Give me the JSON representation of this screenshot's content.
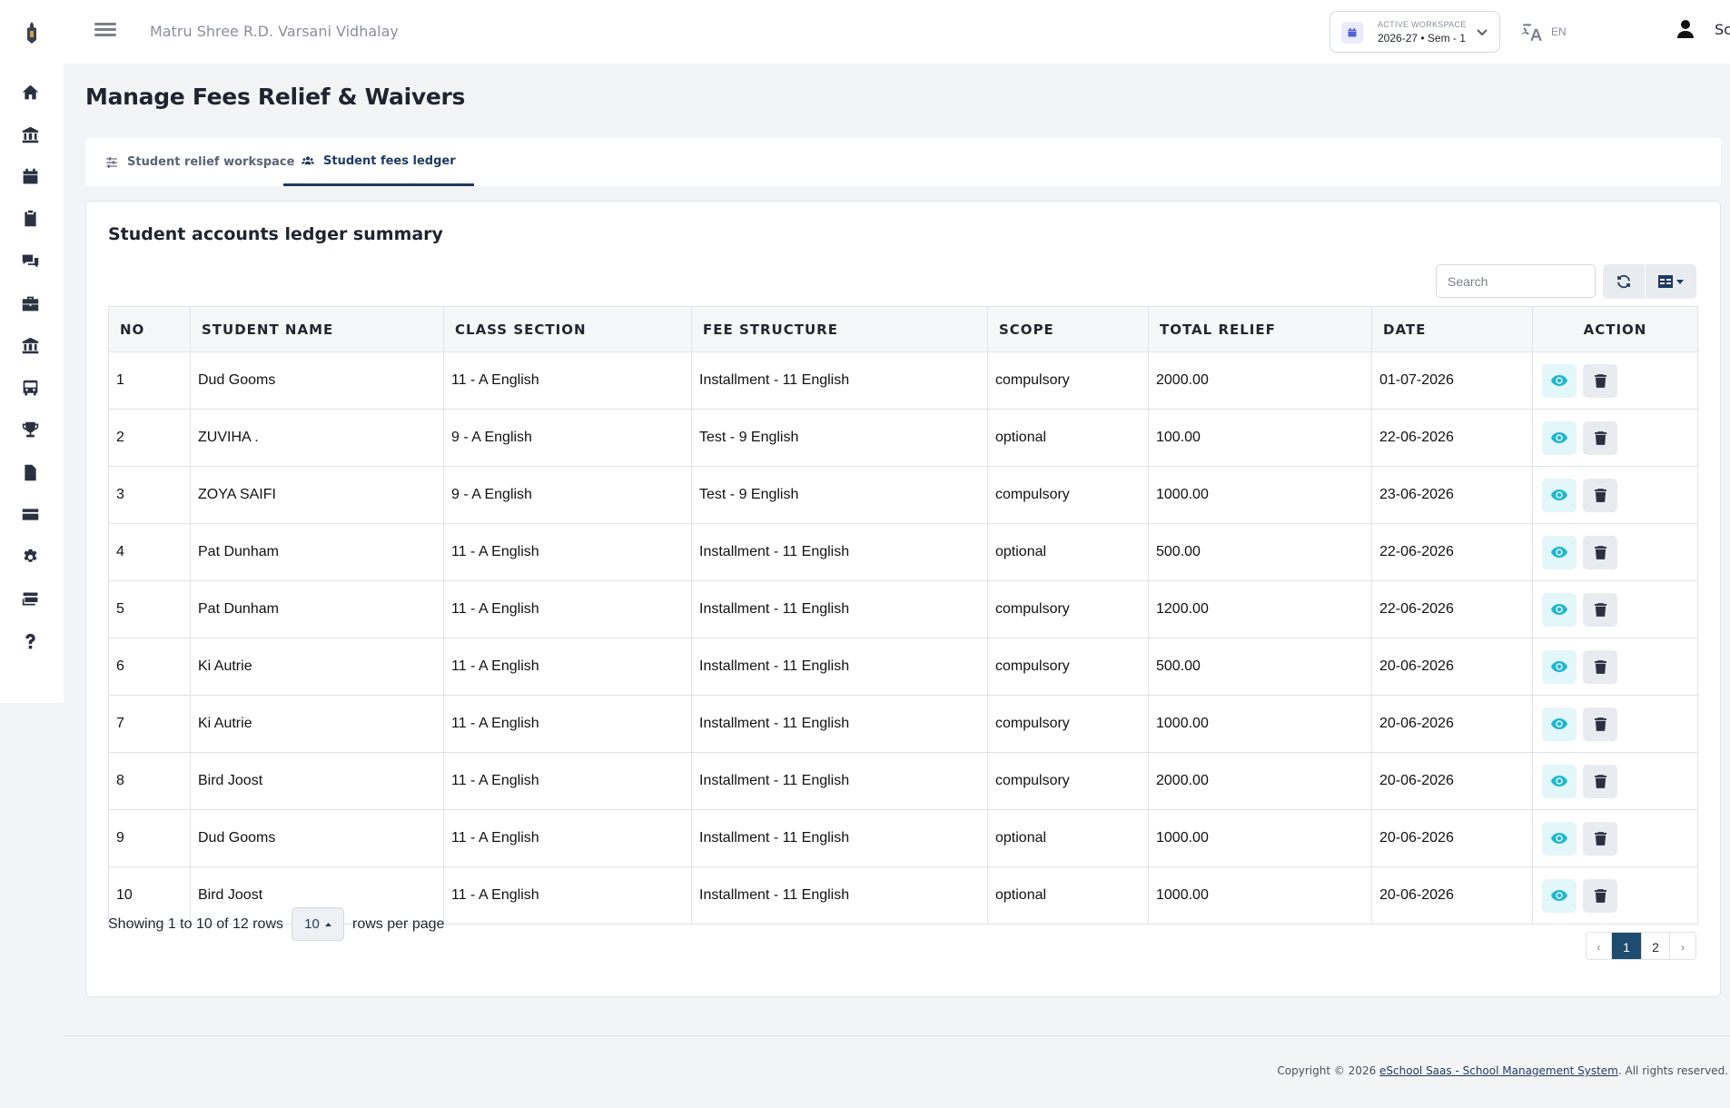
{
  "header": {
    "school_name": "Matru Shree R.D. Varsani Vidhalay",
    "workspace_label": "ACTIVE WORKSPACE",
    "workspace_value": "2026-27 • Sem - 1",
    "language": "EN",
    "user_name": "School"
  },
  "sidebar": {
    "icons": [
      "home-icon",
      "bank-icon",
      "calendar-icon",
      "clipboard-icon",
      "chat-icon",
      "briefcase-icon",
      "institution-icon",
      "bus-icon",
      "trophy-icon",
      "document-icon",
      "card-icon",
      "gear-icon",
      "money-icon",
      "help-icon"
    ]
  },
  "page": {
    "title": "Manage Fees Relief & Waivers"
  },
  "tabs": [
    {
      "label": "Student relief workspace",
      "icon": "sliders-icon"
    },
    {
      "label": "Student fees ledger",
      "icon": "users-icon"
    }
  ],
  "card": {
    "title": "Student accounts ledger summary",
    "search_placeholder": "Search"
  },
  "table": {
    "headers": [
      "NO",
      "STUDENT NAME",
      "CLASS SECTION",
      "FEE STRUCTURE",
      "SCOPE",
      "TOTAL RELIEF",
      "DATE",
      "ACTION"
    ],
    "rows": [
      [
        "1",
        "Dud Gooms",
        "11 - A English",
        "Installment - 11 English",
        "compulsory",
        "2000.00",
        "01-07-2026"
      ],
      [
        "2",
        "ZUVIHA .",
        "9 - A English",
        "Test - 9 English",
        "optional",
        "100.00",
        "22-06-2026"
      ],
      [
        "3",
        "ZOYA SAIFI",
        "9 - A English",
        "Test - 9 English",
        "compulsory",
        "1000.00",
        "23-06-2026"
      ],
      [
        "4",
        "Pat Dunham",
        "11 - A English",
        "Installment - 11 English",
        "optional",
        "500.00",
        "22-06-2026"
      ],
      [
        "5",
        "Pat Dunham",
        "11 - A English",
        "Installment - 11 English",
        "compulsory",
        "1200.00",
        "22-06-2026"
      ],
      [
        "6",
        "Ki Autrie",
        "11 - A English",
        "Installment - 11 English",
        "compulsory",
        "500.00",
        "20-06-2026"
      ],
      [
        "7",
        "Ki Autrie",
        "11 - A English",
        "Installment - 11 English",
        "compulsory",
        "1000.00",
        "20-06-2026"
      ],
      [
        "8",
        "Bird Joost",
        "11 - A English",
        "Installment - 11 English",
        "compulsory",
        "2000.00",
        "20-06-2026"
      ],
      [
        "9",
        "Dud Gooms",
        "11 - A English",
        "Installment - 11 English",
        "optional",
        "1000.00",
        "20-06-2026"
      ],
      [
        "10",
        "Bird Joost",
        "11 - A English",
        "Installment - 11 English",
        "optional",
        "1000.00",
        "20-06-2026"
      ]
    ]
  },
  "pagination": {
    "showing_text": "Showing 1 to 10 of 12 rows",
    "rows_per_page": "10",
    "rows_per_page_label": "rows per page",
    "prev": "‹",
    "pages": [
      "1",
      "2"
    ],
    "next": "›"
  },
  "footer": {
    "prefix": "Copyright © 2026 ",
    "link": "eSchool Saas - School Management System",
    "suffix": ". All rights reserved."
  },
  "colors": {
    "accent": "#1e3a5f",
    "eye_button": "#20b6cc",
    "active_page": "#1e4b6e"
  }
}
